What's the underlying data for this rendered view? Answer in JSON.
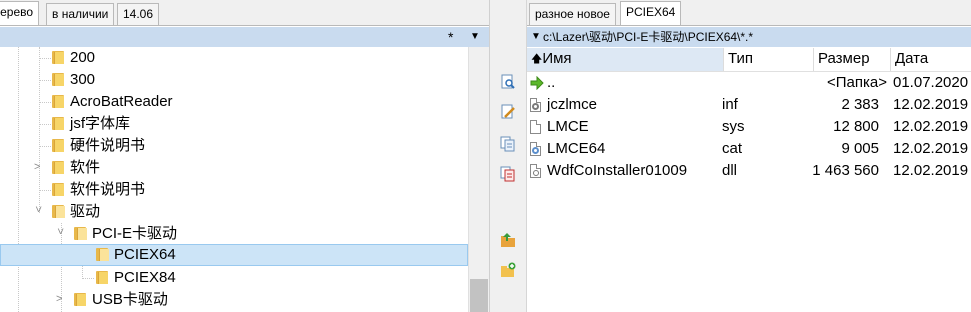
{
  "left_tabs": [
    {
      "label": "Дерево"
    },
    {
      "label": "в наличии"
    },
    {
      "label": "14.06"
    }
  ],
  "left_filter": {
    "mask": "*"
  },
  "tree": [
    {
      "label": "200"
    },
    {
      "label": "300"
    },
    {
      "label": "AcroBatReader"
    },
    {
      "label": "jsf字体库"
    },
    {
      "label": "硬件说明书"
    },
    {
      "label": "软件"
    },
    {
      "label": "软件说明书"
    },
    {
      "label": "驱动"
    },
    {
      "label": "PCI-E卡驱动"
    },
    {
      "label": "PCIEX64"
    },
    {
      "label": "PCIEX84"
    },
    {
      "label": "USB卡驱动"
    }
  ],
  "right_tabs": [
    {
      "label": "разное новое"
    },
    {
      "label": "PCIEX64"
    }
  ],
  "path": "c:\\Lazer\\驱动\\PCI-E卡驱动\\PCIEX64\\*.*",
  "columns": {
    "name": "Имя",
    "type": "Тип",
    "size": "Размер",
    "date": "Дата"
  },
  "files": [
    {
      "name": "..",
      "type": "",
      "size": "<Папка>",
      "date": "01.07.2020",
      "icon": "up-arrow-icon"
    },
    {
      "name": "jczlmce",
      "type": "inf",
      "size": "2 383",
      "date": "12.02.2019",
      "icon": "settings-file-icon"
    },
    {
      "name": "LMCE",
      "type": "sys",
      "size": "12 800",
      "date": "12.02.2019",
      "icon": "file-icon"
    },
    {
      "name": "LMCE64",
      "type": "cat",
      "size": "9 005",
      "date": "12.02.2019",
      "icon": "catalog-file-icon"
    },
    {
      "name": "WdfCoInstaller01009",
      "type": "dll",
      "size": "1 463 560",
      "date": "12.02.2019",
      "icon": "dll-file-icon"
    }
  ],
  "colors": {
    "selection": "#cce4f7",
    "header_bar": "#c9dbef",
    "folder": "#f7d568"
  }
}
